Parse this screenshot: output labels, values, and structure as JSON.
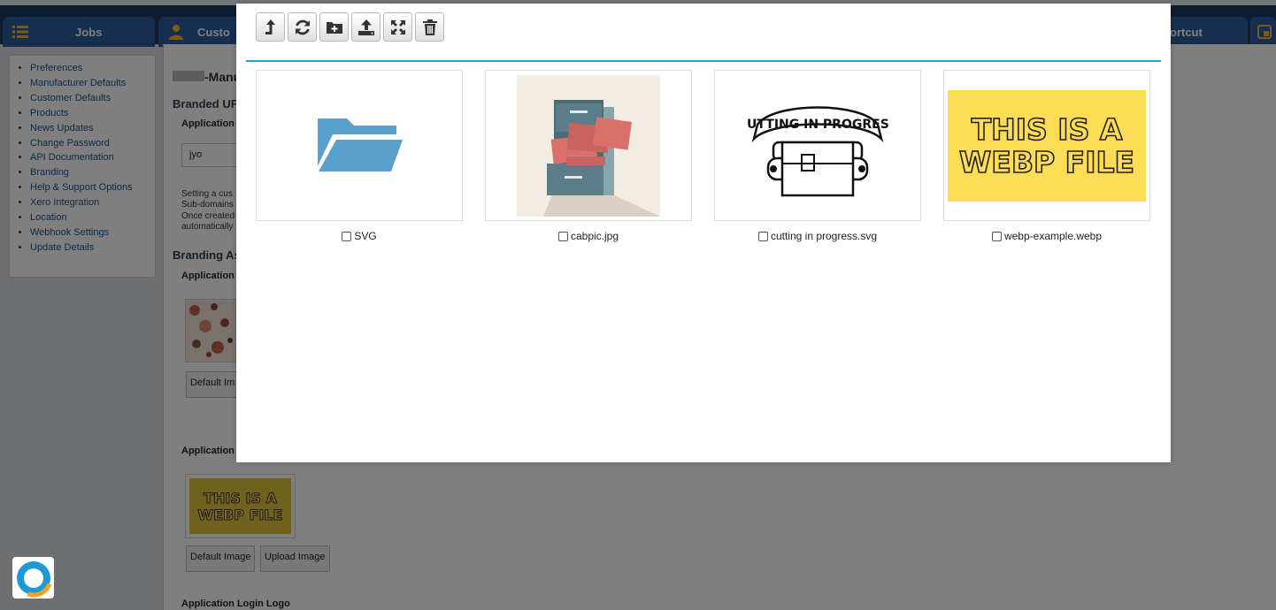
{
  "navbar": {
    "tabs": [
      {
        "label": "Jobs",
        "icon": "list-icon"
      },
      {
        "label": "Custo",
        "icon": "user-icon"
      },
      {
        "label": "ortcut",
        "icon": ""
      },
      {
        "label": "",
        "icon": "external-window-icon"
      }
    ]
  },
  "sidebar": {
    "items": [
      "Preferences",
      "Manufacturer Defaults",
      "Customer Defaults",
      "Products",
      "News Updates",
      "Change Password",
      "API Documentation",
      "Branding",
      "Help & Support Options",
      "Xero Integration",
      "Location",
      "Webhook Settings",
      "Update Details"
    ]
  },
  "main": {
    "title": "-Manu",
    "branded_heading": "Branded UF",
    "application_label": "Application",
    "subdomain_value": "jyo",
    "help_lines": [
      "Setting a cus",
      "Sub-domains",
      "Once created",
      "automatically"
    ],
    "assets_heading": "Branding As",
    "assets_label": "Application",
    "default_image_btn_1": "Default Im",
    "application_label_2": "Application",
    "webp_thumb_line1": "THIS IS A",
    "webp_thumb_line2": "WEBP FILE",
    "default_image_btn_2": "Default Image",
    "upload_image_btn": "Upload Image",
    "login_logo_label": "Application Login Logo"
  },
  "modal": {
    "toolbar": [
      {
        "name": "up-folder",
        "icon": "arrow-up-icon"
      },
      {
        "name": "refresh",
        "icon": "refresh-icon"
      },
      {
        "name": "new-folder",
        "icon": "folder-plus-icon"
      },
      {
        "name": "upload",
        "icon": "upload-icon"
      },
      {
        "name": "fullscreen",
        "icon": "expand-icon"
      },
      {
        "name": "delete",
        "icon": "trash-icon"
      }
    ],
    "files": [
      {
        "name": "SVG",
        "kind": "folder",
        "checked": false
      },
      {
        "name": "cabpic.jpg",
        "kind": "image",
        "checked": false
      },
      {
        "name": "cutting in progress.svg",
        "kind": "image",
        "checked": false
      },
      {
        "name": "webp-example.webp",
        "kind": "image",
        "checked": false
      }
    ],
    "cutting_banner_text": "CUTTING IN PROGRESS",
    "webp_line1": "THIS IS A",
    "webp_line2": "WEBP FILE"
  },
  "colors": {
    "navbar": "#1f3a66",
    "tab": "#2f5f9e",
    "accent_divider": "#1aa7d6",
    "folder": "#5aa0cc",
    "webp_yellow": "#fedd56",
    "link": "#1d4f91"
  }
}
